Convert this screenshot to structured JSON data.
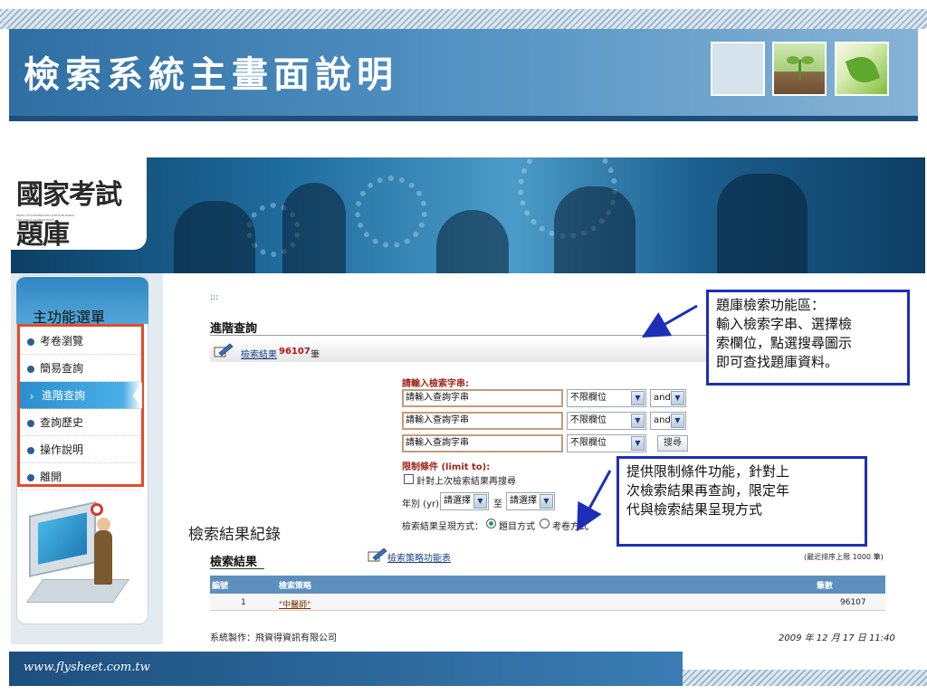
{
  "slide": {
    "title": "檢索系統主畫面說明",
    "footer_url": "www.flysheet.com.tw"
  },
  "logo": {
    "name": "國家考試題庫",
    "tagline_1": "INDEX OF EXAMINATION QUESTION BANKS",
    "tagline_2": "FOR PUBLIC EXAMINATIONS"
  },
  "sidebar": {
    "label": "主功能選單",
    "items": [
      {
        "label": "考卷瀏覽",
        "active": false
      },
      {
        "label": "簡易查詢",
        "active": false
      },
      {
        "label": "進階查詢",
        "active": true
      },
      {
        "label": "查詢歷史",
        "active": false
      },
      {
        "label": "操作說明",
        "active": false
      },
      {
        "label": "離開",
        "active": false
      }
    ]
  },
  "advanced": {
    "dots": ":::",
    "title": "進階查詢",
    "result_link": "檢索結果",
    "result_count": "96107",
    "result_unit": "筆",
    "query_heading": "請輸入檢索字串:",
    "rows": [
      {
        "placeholder": "請輸入查詢字串",
        "field": "不限欄位",
        "op": "and"
      },
      {
        "placeholder": "請輸入查詢字串",
        "field": "不限欄位",
        "op": "and"
      },
      {
        "placeholder": "請輸入查詢字串",
        "field": "不限欄位",
        "button": "搜尋"
      }
    ],
    "limit_heading": "限制條件 (limit to):",
    "limit_checkbox": "針對上次檢索結果再搜尋",
    "year_label": "年別 (yr)",
    "year_from": "請選擇",
    "year_to_sep": "至",
    "year_to": "請選擇",
    "display_label": "檢索結果呈現方式：",
    "display_opt1": "題目方式",
    "display_opt2": "考卷方式"
  },
  "log": {
    "heading": "檢索結果",
    "strategy_link": "檢索策略功能表",
    "limit_note": "(最近排序上限 1000 筆)",
    "columns": [
      "編號",
      "檢索策略",
      "筆數"
    ],
    "rows": [
      {
        "no": "1",
        "strategy": "\"中醫師\"",
        "count": "96107"
      }
    ]
  },
  "page_footer": {
    "left": "系統製作：飛資得資訊有限公司",
    "right": "2009 年 12 月 17 日 11:40"
  },
  "annotations": {
    "log_label": "檢索結果紀錄",
    "callout_1": [
      "題庫檢索功能區：",
      "輸入檢索字串、選擇檢",
      "索欄位，點選搜尋圖示",
      "即可查找題庫資料。"
    ],
    "callout_2": [
      "提供限制條件功能，針對上",
      "次檢索結果再查詢，限定年",
      "代與檢索結果呈現方式"
    ]
  },
  "colors": {
    "title_bar": "#2f6ea3",
    "callout_border": "#1d2fb8",
    "menu_frame": "#e54a2a",
    "menu_active": "#2b8fd0"
  }
}
